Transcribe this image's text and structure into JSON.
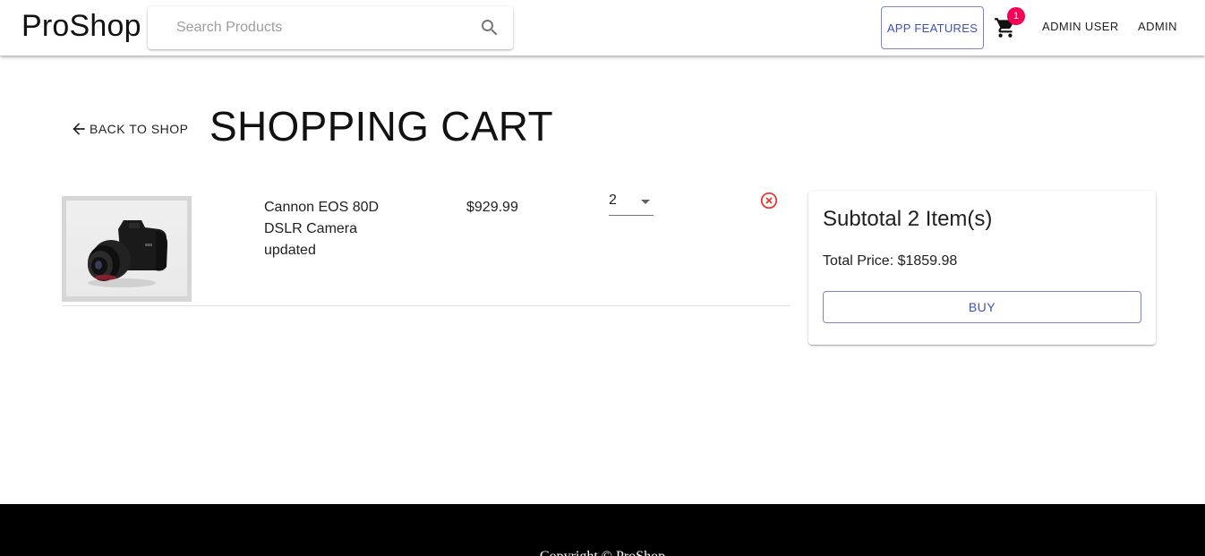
{
  "header": {
    "logo": "ProShop",
    "search_placeholder": "Search Products",
    "features_label": "APP FEATURES",
    "cart_count": "1",
    "user_label": "ADMIN USER",
    "admin_label": "ADMIN"
  },
  "page": {
    "back_label": "BACK TO SHOP",
    "title": "SHOPPING CART"
  },
  "cart": {
    "items": [
      {
        "name": "Cannon EOS 80D DSLR Camera updated",
        "price": "$929.99",
        "qty": "2"
      }
    ]
  },
  "summary": {
    "title": "Subtotal 2 Item(s)",
    "total": "Total Price: $1859.98",
    "buy_label": "BUY"
  },
  "footer": {
    "text": "Copyright © ProShop"
  },
  "colors": {
    "primary": "#3f51b5",
    "badge": "#f50057",
    "remove": "#e53935",
    "footer_bg": "#000000"
  }
}
